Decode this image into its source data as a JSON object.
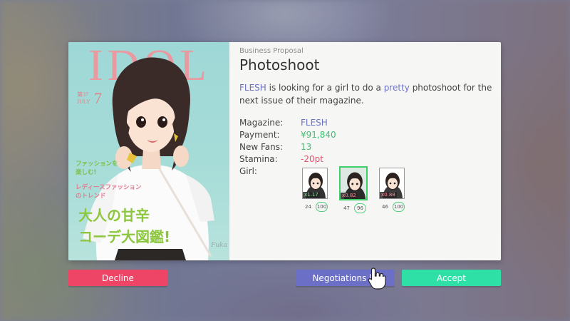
{
  "cover": {
    "title": "IDOL",
    "issue_vol": "第37",
    "issue_month": "JULY",
    "issue_num": "7",
    "tagline_1": "ファッションを",
    "tagline_2": "楽しむ!",
    "tagline_3": "レディースファッション",
    "tagline_4": "のトレンド",
    "headline_1": "大人の甘辛",
    "headline_2": "コーデ大図鑑!",
    "signature": "Fuka"
  },
  "proposal": {
    "eyebrow": "Business Proposal",
    "title": "Photoshoot",
    "desc_brand": "FLESH",
    "desc_part1": " is looking for a girl to do a ",
    "desc_adj": "pretty",
    "desc_part2": " photoshoot for the next issue of their magazine."
  },
  "details": {
    "magazine_label": "Magazine:",
    "magazine_value": "FLESH",
    "payment_label": "Payment:",
    "payment_value": "¥91,840",
    "fans_label": "New Fans:",
    "fans_value": "13",
    "stamina_label": "Stamina:",
    "stamina_value": "-20pt",
    "girl_label": "Girl:"
  },
  "girls": [
    {
      "multiplier": "x1.17",
      "stat_a": "24",
      "stat_b": "100",
      "selected": false,
      "trend": "up"
    },
    {
      "multiplier": "x0.82",
      "stat_a": "47",
      "stat_b": "96",
      "selected": true,
      "trend": "down"
    },
    {
      "multiplier": "x0.88",
      "stat_a": "46",
      "stat_b": "100",
      "selected": false,
      "trend": "down"
    }
  ],
  "buttons": {
    "decline": "Decline",
    "negotiations": "Negotiations [5",
    "accept": "Accept"
  },
  "colors": {
    "accent": "#6b73c4",
    "decline": "#ee4466",
    "accept": "#2fe0a6",
    "negotiations": "#6b6fc6",
    "positive": "#3fbf74",
    "negative": "#e8506f"
  }
}
